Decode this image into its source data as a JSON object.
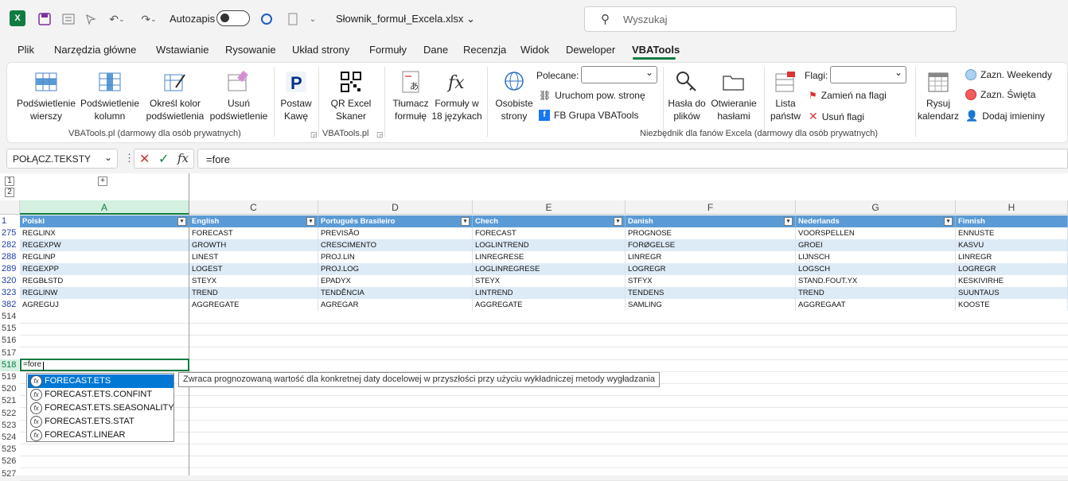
{
  "titlebar": {
    "autosave_label": "Autozapis",
    "filename": "Słownik_formuł_Excela.xlsx",
    "search_placeholder": "Wyszukaj"
  },
  "menu": [
    "Plik",
    "Narzędzia główne",
    "Wstawianie",
    "Rysowanie",
    "Układ strony",
    "Formuły",
    "Dane",
    "Recenzja",
    "Widok",
    "Deweloper",
    "VBATools"
  ],
  "ribbon": {
    "buttons": {
      "row_hl": "Podświetlenie wierszy",
      "col_hl": "Podświetlenie kolumn",
      "color": "Określ kolor podświetlenia",
      "remove": "Usuń podświetlenie",
      "coffee": "Postaw Kawę",
      "qr": "QR Excel Skaner",
      "translate": "Tłumacz formułę",
      "formulas": "Formuły w 18 językach",
      "own": "Osobiste strony",
      "pass": "Hasła do plików",
      "open_pass": "Otwieranie hasłami",
      "countries": "Lista państw",
      "calendar": "Rysuj kalendarz"
    },
    "polecane_label": "Polecane:",
    "run_page": "Uruchom pow. stronę",
    "fb": "FB Grupa VBATools",
    "flags_label": "Flagi:",
    "replace_flag": "Zamień na flagi",
    "remove_flags": "Usuń flagi",
    "weekend": "Zazn. Weekendy",
    "holidays": "Zazn. Święta",
    "nameday": "Dodaj imieniny",
    "group1": "VBATools.pl (darmowy dla osób prywatnych)",
    "group2": "VBATools.pl",
    "group3": "Niezbędnik dla fanów Excela (darmowy dla osób prywatnych)"
  },
  "formula_bar": {
    "name_box": "POŁĄCZ.TEKSTY",
    "formula": "=fore"
  },
  "columns": [
    "A",
    "C",
    "D",
    "E",
    "F",
    "G",
    "H"
  ],
  "headers": [
    "Polski",
    "English",
    "Português Brasileiro",
    "Chech",
    "Danish",
    "Nederlands",
    "Finnish"
  ],
  "rows": [
    {
      "n": "275",
      "cells": [
        "REGLINX",
        "FORECAST",
        "PREVISÃO",
        "FORECAST",
        "PROGNOSE",
        "VOORSPELLEN",
        "ENNUSTE"
      ]
    },
    {
      "n": "282",
      "cells": [
        "REGEXPW",
        "GROWTH",
        "CRESCIMENTO",
        "LOGLINTREND",
        "FORØGELSE",
        "GROEI",
        "KASVU"
      ]
    },
    {
      "n": "288",
      "cells": [
        "REGLINP",
        "LINEST",
        "PROJ.LIN",
        "LINREGRESE",
        "LINREGR",
        "LIJNSCH",
        "LINREGR"
      ]
    },
    {
      "n": "289",
      "cells": [
        "REGEXPP",
        "LOGEST",
        "PROJ.LOG",
        "LOGLINREGRESE",
        "LOGREGR",
        "LOGSCH",
        "LOGREGR"
      ]
    },
    {
      "n": "320",
      "cells": [
        "REGBŁSTD",
        "STEYX",
        "EPADYX",
        "STEYX",
        "STFYX",
        "STAND.FOUT.YX",
        "KESKIVIRHE"
      ]
    },
    {
      "n": "323",
      "cells": [
        "REGLINW",
        "TREND",
        "TENDÊNCIA",
        "LINTREND",
        "TENDENS",
        "TREND",
        "SUUNTAUS"
      ]
    },
    {
      "n": "382",
      "cells": [
        "AGREGUJ",
        "AGGREGATE",
        "AGREGAR",
        "AGGREGATE",
        "SAMLING",
        "AGGREGAAT",
        "KOOSTE"
      ]
    }
  ],
  "empty_rows": [
    "514",
    "515",
    "516",
    "517",
    "518",
    "519",
    "520",
    "521",
    "522",
    "523",
    "524",
    "525",
    "526",
    "527"
  ],
  "active_cell_text": "=fore",
  "autocomplete": [
    "FORECAST.ETS",
    "FORECAST.ETS.CONFINT",
    "FORECAST.ETS.SEASONALITY",
    "FORECAST.ETS.STAT",
    "FORECAST.LINEAR"
  ],
  "tooltip": "Zwraca prognozowaną wartość dla konkretnej daty docelowej w przyszłości przy użyciu wykładniczej metody wygładzania",
  "colors": {
    "excel_green": "#107c41",
    "table_header": "#5b9bd5",
    "band": "#ddebf7",
    "ac_selected": "#0078d4"
  }
}
